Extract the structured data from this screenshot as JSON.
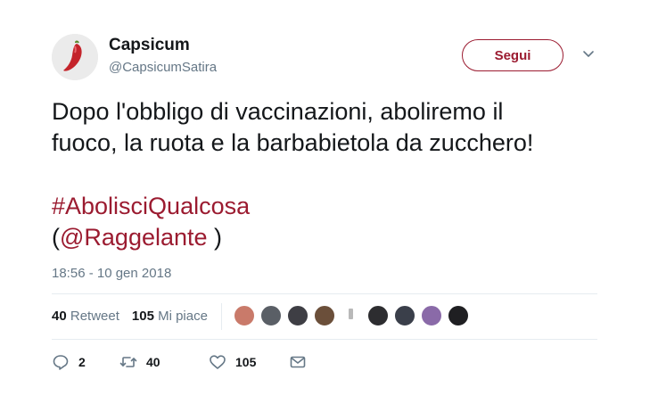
{
  "account": {
    "name": "Capsicum",
    "handle": "@CapsicumSatira",
    "avatar_icon": "chili-pepper-icon"
  },
  "follow_button": {
    "label": "Segui"
  },
  "menu": {
    "icon": "chevron-down-icon"
  },
  "tweet": {
    "line1": "Dopo l'obbligo di vaccinazioni, aboliremo il",
    "line2": "fuoco, la ruota e la barbabietola da zucchero!",
    "hashtag": "#AbolisciQualcosa",
    "mention_open": "(",
    "mention": "@Raggelante",
    "mention_close": " )",
    "timestamp": "18:56 - 10 gen 2018"
  },
  "stats": {
    "retweets_count": "40",
    "retweets_label": "Retweet",
    "likes_count": "105",
    "likes_label": "Mi piace"
  },
  "liked_by_avatars": [
    {
      "name": "avatar-liker-1",
      "color": "#c97a6a"
    },
    {
      "name": "avatar-liker-2",
      "color": "#5a5f66"
    },
    {
      "name": "avatar-liker-3",
      "color": "#3e3e44"
    },
    {
      "name": "avatar-liker-4",
      "color": "#6b4f3a"
    },
    {
      "name": "avatar-liker-5",
      "color": "#ffffff"
    },
    {
      "name": "avatar-liker-6",
      "color": "#2d2d30"
    },
    {
      "name": "avatar-liker-7",
      "color": "#3a3f4a"
    },
    {
      "name": "avatar-liker-8",
      "color": "#8a6aa8"
    },
    {
      "name": "avatar-liker-9",
      "color": "#1f1f22"
    }
  ],
  "actions": {
    "reply_count": "2",
    "retweet_count": "40",
    "like_count": "105"
  },
  "colors": {
    "accent": "#9b1b30",
    "muted": "#657786",
    "text": "#14171a",
    "divider": "#e6ecf0"
  }
}
